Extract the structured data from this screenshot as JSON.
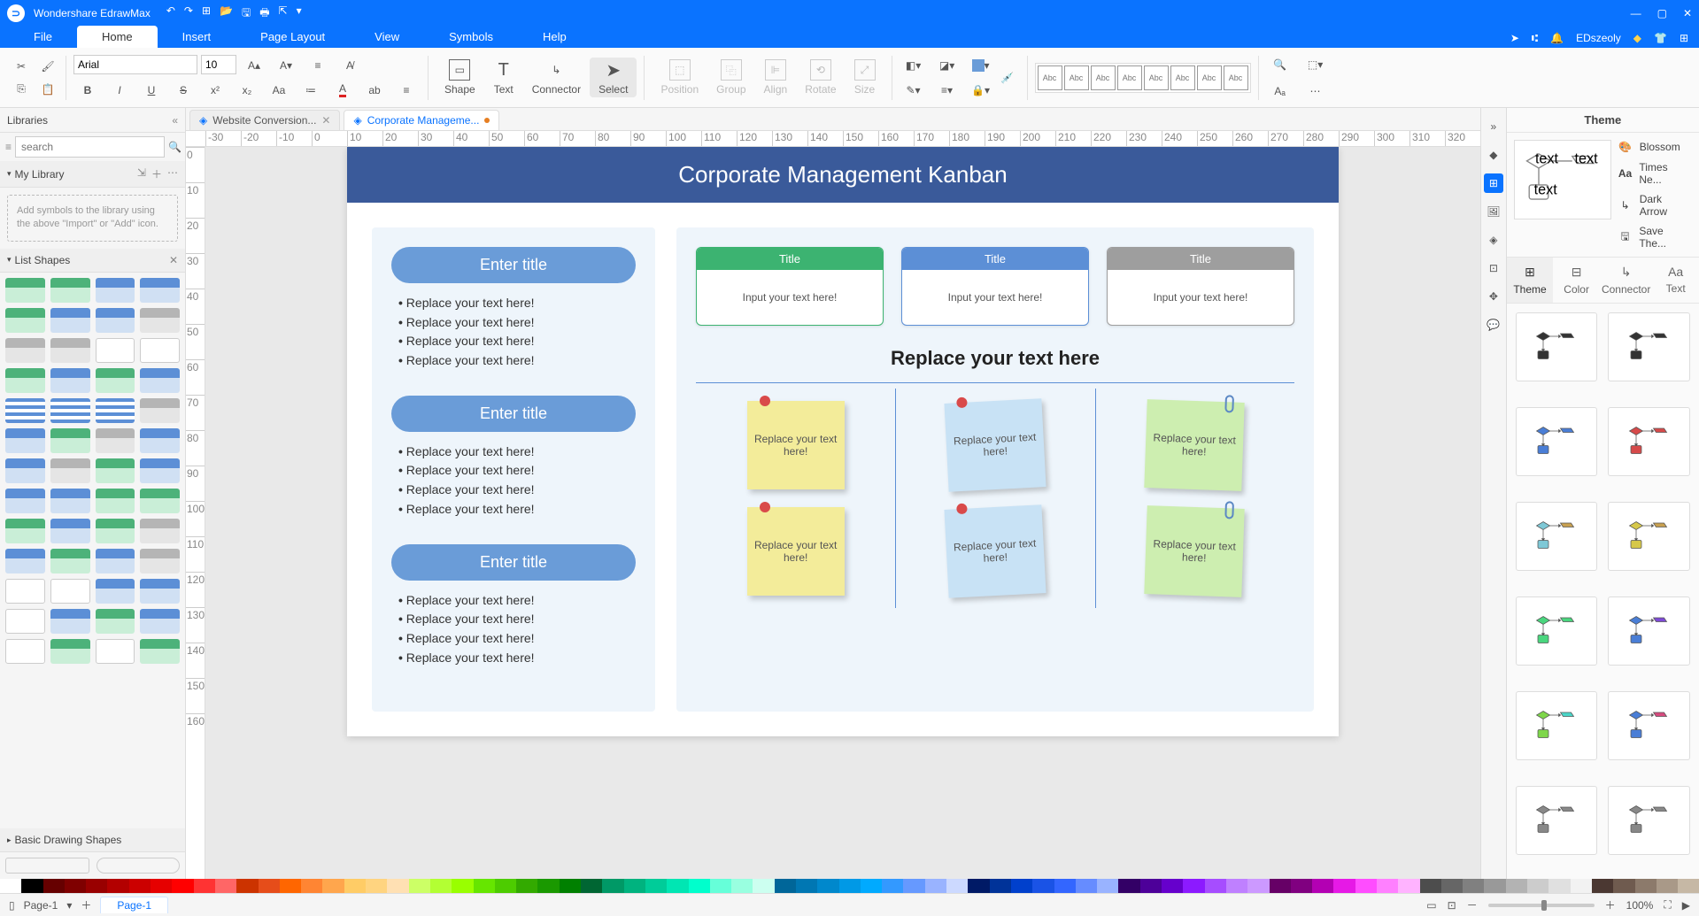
{
  "app": {
    "name": "Wondershare EdrawMax"
  },
  "menubar": {
    "tabs": [
      "File",
      "Home",
      "Insert",
      "Page Layout",
      "View",
      "Symbols",
      "Help"
    ],
    "active": 1,
    "user": "EDszeoly"
  },
  "ribbon": {
    "font": "Arial",
    "size": "10",
    "big": {
      "shape": "Shape",
      "text": "Text",
      "connector": "Connector",
      "select": "Select"
    },
    "arrange": {
      "position": "Position",
      "group": "Group",
      "align": "Align",
      "rotate": "Rotate",
      "size": "Size"
    },
    "gallery_label": "Abc"
  },
  "lib": {
    "title": "Libraries",
    "search_ph": "search",
    "mylibrary": "My Library",
    "empty": "Add symbols to the library using the above \"Import\" or \"Add\" icon.",
    "list_shapes": "List Shapes",
    "basic": "Basic Drawing Shapes"
  },
  "tabs": {
    "t0": "Website Conversion...",
    "t1": "Corporate Manageme..."
  },
  "ruler": [
    "-30",
    "-20",
    "-10",
    "0",
    "10",
    "20",
    "30",
    "40",
    "50",
    "60",
    "70",
    "80",
    "90",
    "100",
    "110",
    "120",
    "130",
    "140",
    "150",
    "160",
    "170",
    "180",
    "190",
    "200",
    "210",
    "220",
    "230",
    "240",
    "250",
    "260",
    "270",
    "280",
    "290",
    "300",
    "310",
    "320"
  ],
  "rulerV": [
    "0",
    "10",
    "20",
    "30",
    "40",
    "50",
    "60",
    "70",
    "80",
    "90",
    "100",
    "110",
    "120",
    "130",
    "140",
    "150",
    "160"
  ],
  "doc": {
    "banner": "Corporate Management Kanban",
    "pill": "Enter title",
    "bullet": "Replace your text here!",
    "card_title": "Title",
    "card_body": "Input your text here!",
    "sub": "Replace your text here",
    "sticky": "Replace your text here!"
  },
  "theme": {
    "title": "Theme",
    "rows": [
      "Blossom",
      "Times Ne...",
      "Dark Arrow",
      "Save The..."
    ],
    "tabs": [
      "Theme",
      "Color",
      "Connector",
      "Text"
    ]
  },
  "status": {
    "page": "Page-1",
    "pagetab": "Page-1",
    "zoom": "100%"
  },
  "palette": [
    "#ffffff",
    "#000000",
    "#660000",
    "#7f0000",
    "#990000",
    "#b30000",
    "#cc0000",
    "#e60000",
    "#ff0000",
    "#ff3333",
    "#ff6666",
    "#cc3300",
    "#e64d1a",
    "#ff6600",
    "#ff8533",
    "#ffa64d",
    "#ffcc66",
    "#ffd480",
    "#ffe0b3",
    "#ccff66",
    "#b3ff33",
    "#99ff00",
    "#66e600",
    "#4dcc00",
    "#33aa00",
    "#1a9900",
    "#008000",
    "#006633",
    "#009966",
    "#00b37f",
    "#00cc99",
    "#00e6b3",
    "#00ffcc",
    "#66ffd9",
    "#99ffe0",
    "#ccfff0",
    "#006699",
    "#0077b3",
    "#0088cc",
    "#0099e6",
    "#00aaff",
    "#3399ff",
    "#6699ff",
    "#99b3ff",
    "#ccd9ff",
    "#001a66",
    "#003399",
    "#0040cc",
    "#1a53e6",
    "#3366ff",
    "#668cff",
    "#99b3ff",
    "#330066",
    "#4d0099",
    "#6600cc",
    "#8c1aff",
    "#a64dff",
    "#bf80ff",
    "#cc99ff",
    "#660066",
    "#800080",
    "#b300b3",
    "#e619e6",
    "#ff4dff",
    "#ff80ff",
    "#ffb3ff",
    "#4d4d4d",
    "#666666",
    "#808080",
    "#999999",
    "#b3b3b3",
    "#cccccc",
    "#e0e0e0",
    "#f2f2f2",
    "#4b3832",
    "#6f5b4f",
    "#8c7a6b",
    "#a99988",
    "#c6b8a5"
  ]
}
